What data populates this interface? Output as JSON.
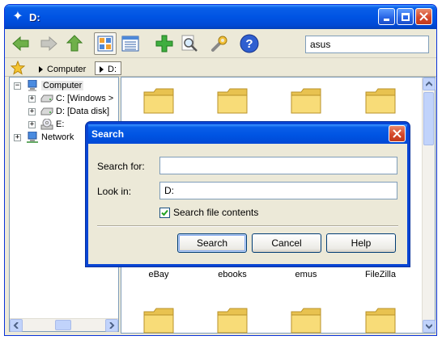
{
  "window": {
    "title": "D:"
  },
  "toolbar": {
    "search_value": "asus",
    "icons": [
      "back-arrow-icon",
      "forward-arrow-icon",
      "up-arrow-icon",
      "thumbnail-view-icon",
      "details-view-icon",
      "add-icon",
      "search-magnifier-icon",
      "tools-wrench-icon",
      "help-icon"
    ]
  },
  "breadcrumb": {
    "items": [
      "Computer",
      "D:"
    ]
  },
  "tree": {
    "computer": "Computer",
    "c_drive": "C: [Windows >",
    "d_drive": "D: [Data disk]",
    "e_drive": "E:",
    "network": "Network"
  },
  "content": {
    "labels": [
      "eBay",
      "ebooks",
      "emus",
      "FileZilla"
    ]
  },
  "dialog": {
    "title": "Search",
    "search_for_label": "Search for:",
    "search_for_value": "",
    "look_in_label": "Look in:",
    "look_in_value": "D:",
    "search_contents_label": "Search file contents",
    "search_contents_checked": true,
    "search_button": "Search",
    "cancel_button": "Cancel",
    "help_button": "Help"
  },
  "colors": {
    "titlebar": "#0054e3",
    "folder": "#f6d86a",
    "window_bg": "#ece9d8"
  }
}
